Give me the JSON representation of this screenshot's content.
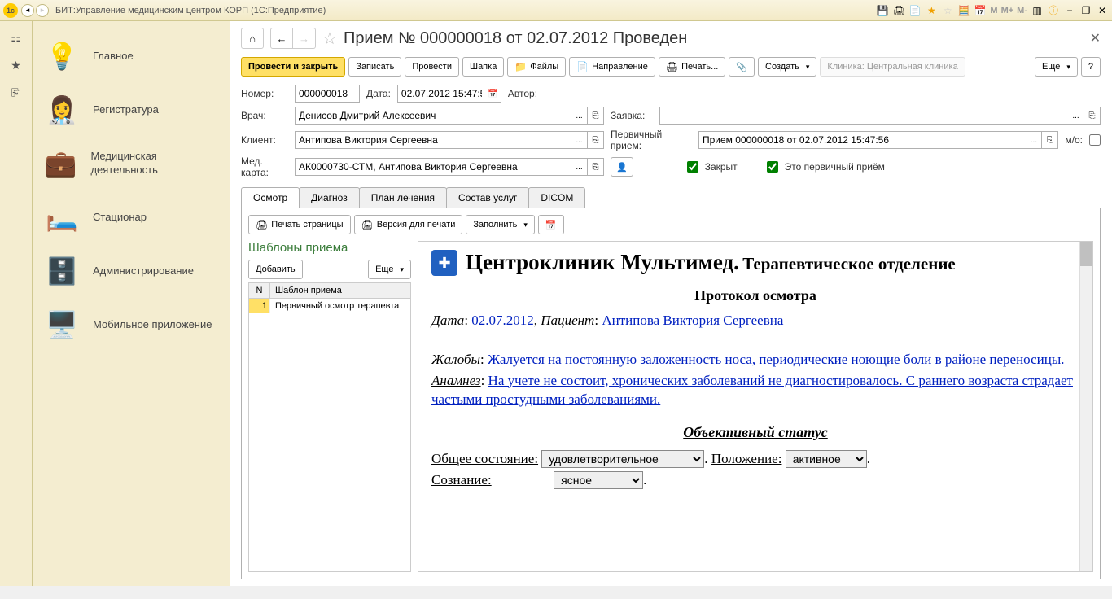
{
  "titlebar": {
    "title": "БИТ:Управление медицинским центром КОРП  (1С:Предприятие)",
    "memBtns": [
      "M",
      "M+",
      "M-"
    ]
  },
  "leftbar": [
    "⚏",
    "★",
    "⎘"
  ],
  "sidebar": {
    "items": [
      {
        "icon": "💡",
        "label": "Главное"
      },
      {
        "icon": "👩‍⚕️",
        "label": "Регистратура"
      },
      {
        "icon": "💼",
        "label": "Медицинская деятельность"
      },
      {
        "icon": "🛏️",
        "label": "Стационар"
      },
      {
        "icon": "🗄️",
        "label": "Администрирование"
      },
      {
        "icon": "🖥️",
        "label": "Мобильное приложение"
      }
    ]
  },
  "doc": {
    "title": "Прием № 000000018 от 02.07.2012 Проведен",
    "toolbar": {
      "primary": "Провести и закрыть",
      "write": "Записать",
      "post": "Провести",
      "cap": "Шапка",
      "files": "Файлы",
      "napr": "Направление",
      "print": "Печать...",
      "create": "Создать",
      "disabled": "Клиника: Центральная клиника",
      "more": "Еще"
    },
    "fields": {
      "numberLbl": "Номер:",
      "number": "000000018",
      "dateLbl": "Дата:",
      "date": "02.07.2012 15:47:5",
      "authorLbl": "Автор:",
      "doctorLbl": "Врач:",
      "doctor": "Денисов Дмитрий Алексеевич",
      "requestLbl": "Заявка:",
      "clientLbl": "Клиент:",
      "client": "Антипова Виктория Сергеевна",
      "primaryLbl": "Первичный прием:",
      "primary": "Прием 000000018 от 02.07.2012 15:47:56",
      "moLbl": "м/о:",
      "cardLbl": "Мед. карта:",
      "card": "АК0000730-СТМ, Антипова Виктория Сергеевна",
      "closedLbl": "Закрыт",
      "isPrimaryLbl": "Это первичный приём"
    },
    "tabs": [
      "Осмотр",
      "Диагноз",
      "План лечения",
      "Состав услуг",
      "DICOM"
    ],
    "tabToolbar": {
      "printPage": "Печать страницы",
      "printVer": "Версия для печати",
      "fill": "Заполнить"
    },
    "templates": {
      "title": "Шаблоны приема",
      "add": "Добавить",
      "more": "Еще",
      "cols": {
        "n": "N",
        "name": "Шаблон приема"
      },
      "rows": [
        {
          "n": "1",
          "name": "Первичный осмотр терапевта"
        }
      ]
    },
    "protocol": {
      "clinic": "Центроклиник Мультимед.",
      "dept": "Терапевтическое отделение",
      "heading": "Протокол осмотра",
      "dateLbl": "Дата",
      "date": "02.07.2012",
      "patientLbl": "Пациент",
      "patient": "Антипова Виктория Сергеевна",
      "complaintsLbl": "Жалобы",
      "complaints": "Жалуется на постоянную заложенность носа, периодические ноющие боли в районе переносицы.",
      "anamnesisLbl": "Анамнез",
      "anamnesis": "На учете не состоит, хронических заболеваний не диагностировалось. С раннего возраста страдает частыми простудными заболеваниями.",
      "objStatus": "Объективный статус",
      "generalLbl": "Общее состояние:",
      "generalVal": "удовлетворительное",
      "positionLbl": "Положение:",
      "positionVal": "активное",
      "consciousLbl": "Сознание:",
      "consciousVal": "ясное"
    }
  }
}
